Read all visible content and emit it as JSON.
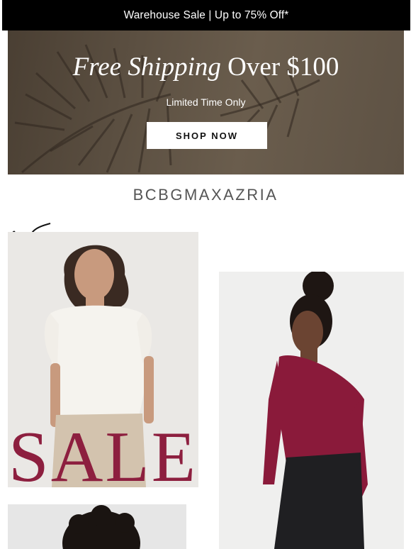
{
  "topbar": {
    "text": "Warehouse Sale | Up to 75% Off*"
  },
  "hero": {
    "title_italic": "Free Shipping",
    "title_rest": " Over $100",
    "subtitle": "Limited Time Only",
    "cta_label": "SHOP NOW"
  },
  "brand": {
    "logo_text": "BCBGMAXAZRIA"
  },
  "promo": {
    "sale_text": "SALE"
  },
  "colors": {
    "accent": "#8d1f3f",
    "topbar_bg": "#000000",
    "hero_bg": "#5b4f41"
  }
}
